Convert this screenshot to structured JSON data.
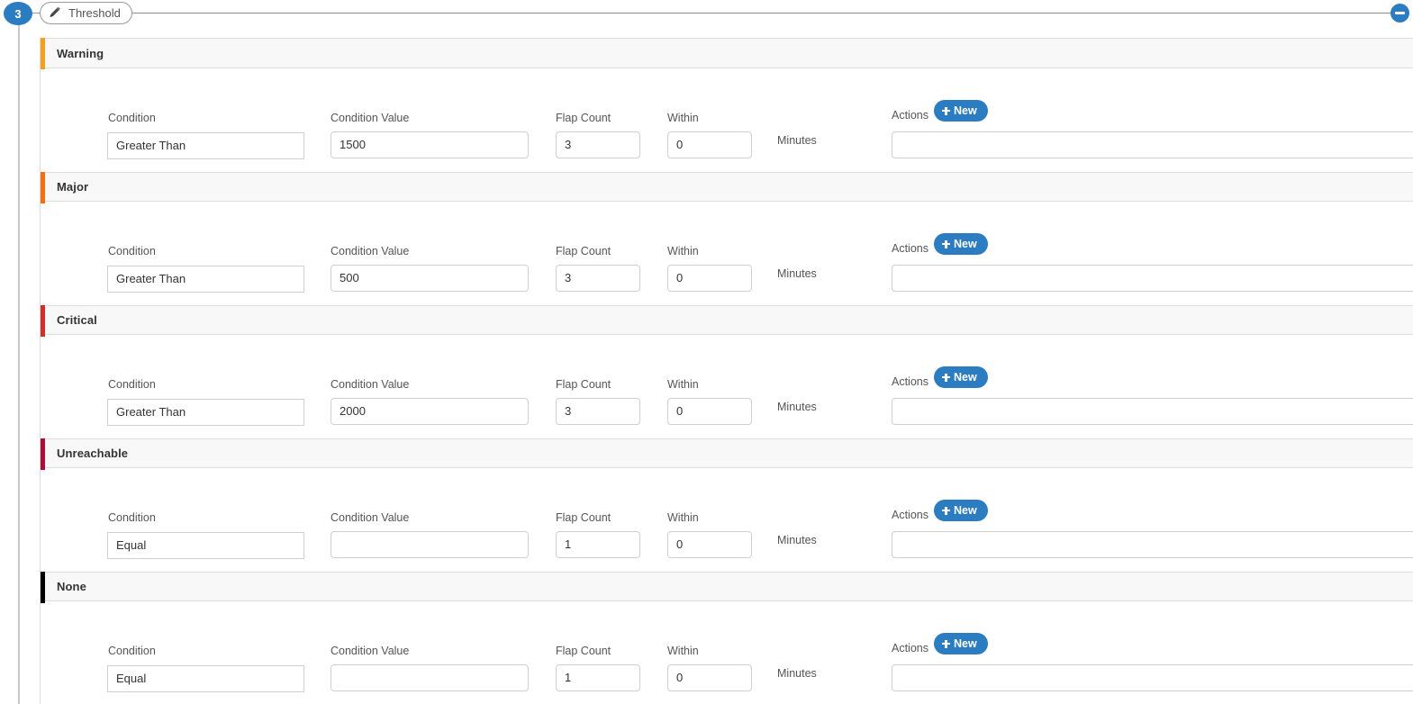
{
  "step": {
    "number": "3",
    "pill_label": "Threshold",
    "pill_icon": "magic-wand-icon",
    "collapse_icon": "minus-circle-icon"
  },
  "labels": {
    "condition": "Condition",
    "condition_value": "Condition Value",
    "flap_count": "Flap Count",
    "within": "Within",
    "minutes": "Minutes",
    "actions": "Actions",
    "new_button": "New"
  },
  "colors": {
    "accent": "#2b7cc0",
    "warning": "#f0a11e",
    "major": "#f2700f",
    "critical": "#d12f2a",
    "unreachable": "#ad0d36",
    "none": "#000000"
  },
  "sections": [
    {
      "name": "Warning",
      "bar_color": "#f0a11e",
      "condition": "Greater Than",
      "condition_value": "1500",
      "flap_count": "3",
      "within": "0",
      "actions_value": ""
    },
    {
      "name": "Major",
      "bar_color": "#f2700f",
      "condition": "Greater Than",
      "condition_value": "500",
      "flap_count": "3",
      "within": "0",
      "actions_value": ""
    },
    {
      "name": "Critical",
      "bar_color": "#d12f2a",
      "condition": "Greater Than",
      "condition_value": "2000",
      "flap_count": "3",
      "within": "0",
      "actions_value": ""
    },
    {
      "name": "Unreachable",
      "bar_color": "#ad0d36",
      "condition": "Equal",
      "condition_value": "",
      "flap_count": "1",
      "within": "0",
      "actions_value": ""
    },
    {
      "name": "None",
      "bar_color": "#000000",
      "condition": "Equal",
      "condition_value": "",
      "flap_count": "1",
      "within": "0",
      "actions_value": ""
    }
  ]
}
